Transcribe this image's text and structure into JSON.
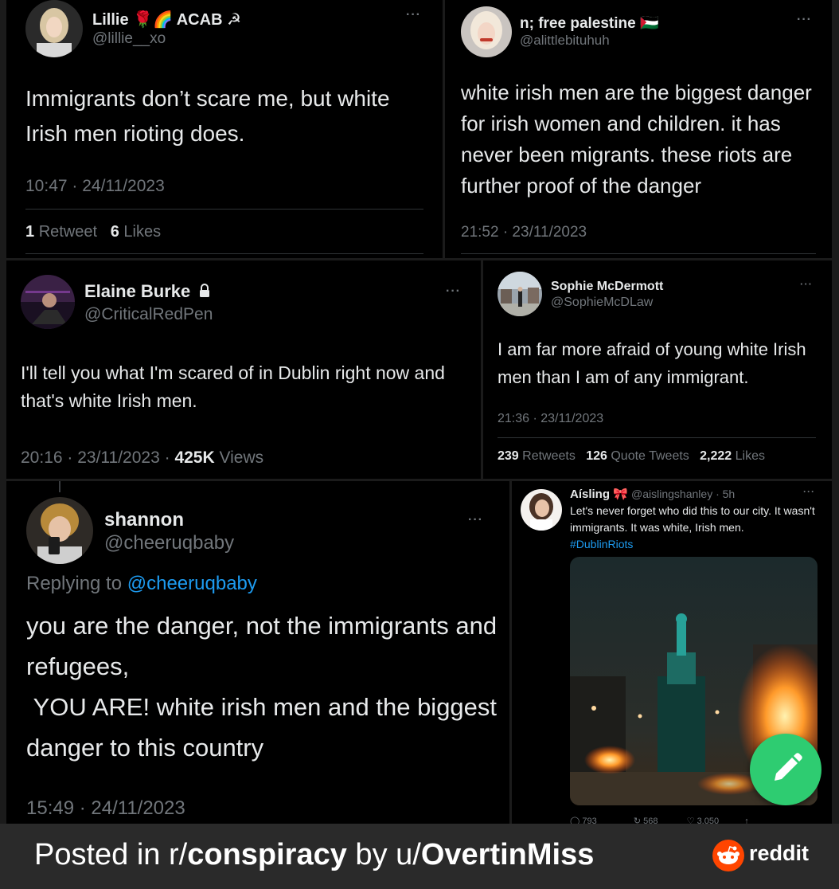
{
  "tweets": {
    "t1": {
      "name": "Lillie 🌹🌈 ACAB ☭",
      "handle": "@lillie__xo",
      "text": "Immigrants don’t scare me, but white Irish men rioting does.",
      "timestamp": "10:47 · 24/11/2023",
      "retweets": "1",
      "retweets_label": "Retweet",
      "likes": "6",
      "likes_label": "Likes",
      "more": "···"
    },
    "t2": {
      "name": "n; free palestine 🇵🇸",
      "handle": "@alittlebituhuh",
      "text": "white irish men are the biggest danger for irish women and children. it has never been migrants. these riots are further proof of the danger",
      "timestamp": "21:52 · 23/11/2023",
      "more": "···"
    },
    "t3": {
      "name": "Elaine Burke",
      "handle": "@CriticalRedPen",
      "text": "I'll tell you what I'm scared of in Dublin right now and that's white Irish men.",
      "timestamp": "20:16 · 23/11/2023 ·",
      "views": "425K",
      "views_label": "Views",
      "more": "···"
    },
    "t4": {
      "name": "Sophie McDermott",
      "handle": "@SophieMcDLaw",
      "text": "I am far more afraid of young white Irish men than I am of any immigrant.",
      "timestamp": "21:36 · 23/11/2023",
      "retweets": "239",
      "retweets_label": "Retweets",
      "quotes": "126",
      "quotes_label": "Quote Tweets",
      "likes": "2,222",
      "likes_label": "Likes",
      "more": "···"
    },
    "t5": {
      "name": "shannon",
      "handle": "@cheeruqbaby",
      "replying_label": "Replying to",
      "replying_to": "@cheeruqbaby",
      "text_line1": "you are the danger, not the immigrants and refugees,",
      "text_line2": " YOU ARE! white irish men and the biggest danger to this country",
      "timestamp": "15:49 · 24/11/2023",
      "more": "···"
    },
    "t6": {
      "name": "Aísling 🎀",
      "handle": "@aislingshanley · 5h",
      "text": "Let's never forget who did this to our city. It wasn't immigrants. It was white, Irish men.",
      "hashtag": "#DublinRiots",
      "replies": "793",
      "retweets": "568",
      "likes": "3,050",
      "more": "···"
    }
  },
  "fab": {
    "icon": "pencil-icon"
  },
  "footer": {
    "posted_in": "Posted in r/",
    "subreddit": "conspiracy",
    "by": " by u/",
    "user": "OvertinMiss",
    "brand": "reddit"
  },
  "colors": {
    "background": "#000000",
    "text": "#e7e9ea",
    "muted": "#71767b",
    "link": "#1d9bf0",
    "fab": "#2ecc71",
    "reddit_orange": "#ff4500"
  }
}
